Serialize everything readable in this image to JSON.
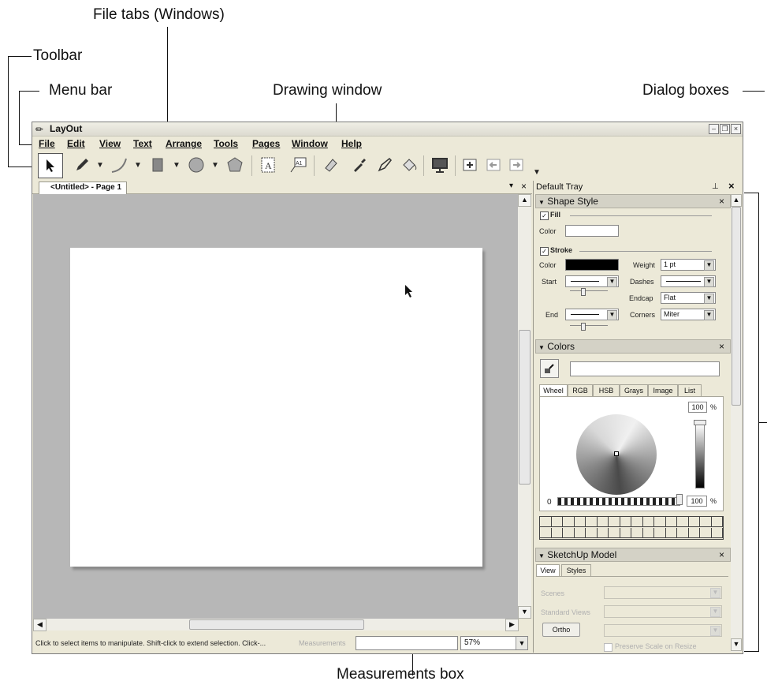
{
  "callouts": {
    "file_tabs": "File tabs (Windows)",
    "toolbar": "Toolbar",
    "menu_bar": "Menu bar",
    "drawing_window": "Drawing window",
    "dialog_boxes": "Dialog boxes",
    "measurements_box": "Measurements box"
  },
  "window": {
    "title": "LayOut"
  },
  "menu": [
    "File",
    "Edit",
    "View",
    "Text",
    "Arrange",
    "Tools",
    "Pages",
    "Window",
    "Help"
  ],
  "toolbar_icons": [
    "select-arrow-icon",
    "pencil-icon",
    "arc-icon",
    "rectangle-icon",
    "circle-icon",
    "polygon-icon",
    "text-icon",
    "label-icon",
    "eraser-icon",
    "eyedropper-icon",
    "style-pen-icon",
    "paint-bucket-icon",
    "presentation-icon",
    "add-page-icon",
    "previous-page-icon",
    "next-page-icon"
  ],
  "file_tab": {
    "label": "<Untitled> - Page 1"
  },
  "status": {
    "hint": "Click to select items to manipulate. Shift-click to extend selection. Click-...",
    "measurements_label": "Measurements",
    "zoom": "57%"
  },
  "tray": {
    "title": "Default Tray",
    "shape_style": {
      "header": "Shape Style",
      "fill_label": "Fill",
      "color_label": "Color",
      "stroke_label": "Stroke",
      "stroke_color_label": "Color",
      "weight_label": "Weight",
      "weight_value": "1 pt",
      "start_label": "Start",
      "dashes_label": "Dashes",
      "endcap_label": "Endcap",
      "endcap_value": "Flat",
      "end_label": "End",
      "corners_label": "Corners",
      "corners_value": "Miter"
    },
    "colors": {
      "header": "Colors",
      "tabs": [
        "Wheel",
        "RGB",
        "HSB",
        "Grays",
        "Image",
        "List"
      ],
      "brightness": "100",
      "opacity": "100",
      "percent": "%",
      "zero": "0"
    },
    "sketchup": {
      "header": "SketchUp Model",
      "tabs": [
        "View",
        "Styles"
      ],
      "scenes_label": "Scenes",
      "standard_views_label": "Standard Views",
      "ortho_label": "Ortho",
      "preserve_label": "Preserve Scale on Resize"
    }
  }
}
